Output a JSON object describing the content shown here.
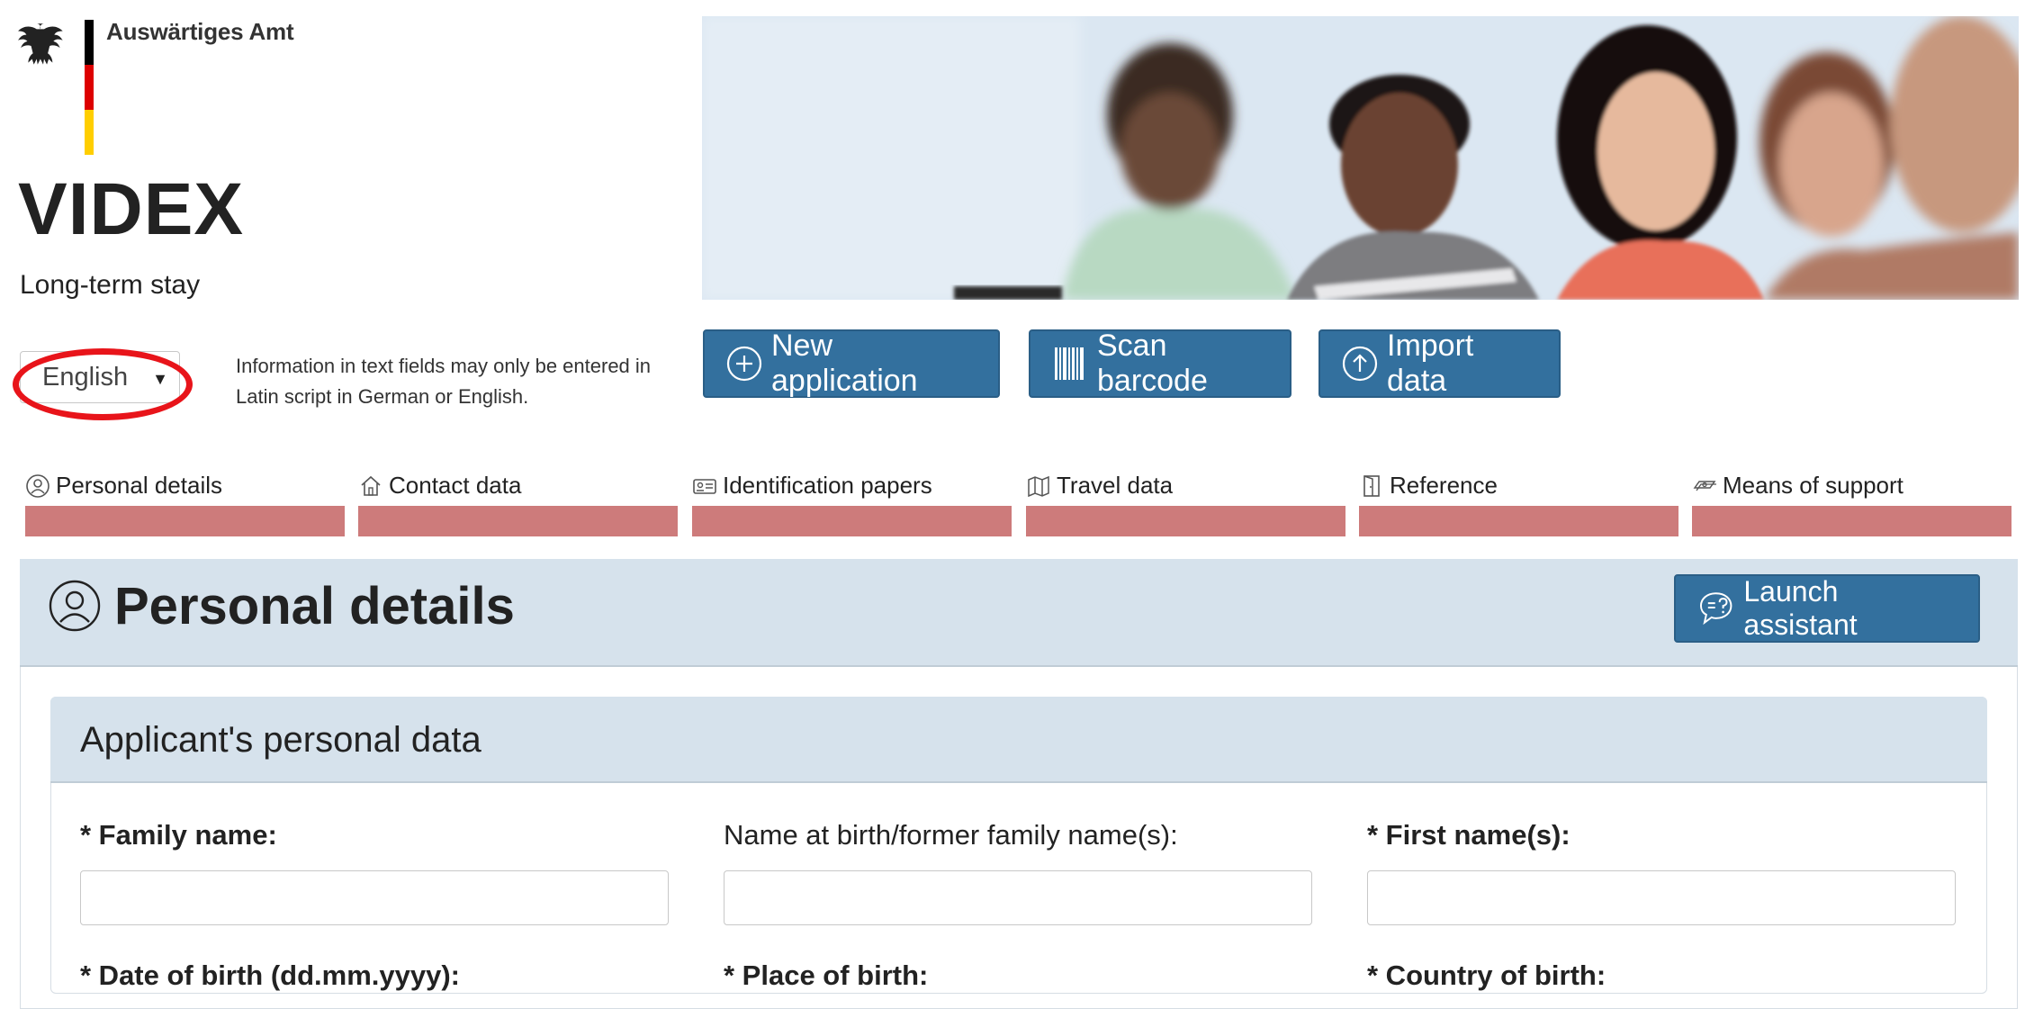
{
  "logo": {
    "ministry": "Auswärtiges Amt",
    "icon": "eagle-icon",
    "flag_colors": [
      "#000000",
      "#dd0000",
      "#ffce00"
    ]
  },
  "app": {
    "title": "VIDEX",
    "subtitle": "Long-term stay"
  },
  "language": {
    "selected": "English"
  },
  "info": {
    "text": "Information in text fields may only be entered in Latin script in German or English."
  },
  "actions": [
    {
      "label": "New application",
      "icon": "plus-circle-icon"
    },
    {
      "label": "Scan barcode",
      "icon": "barcode-icon"
    },
    {
      "label": "Import data",
      "icon": "upload-circle-icon"
    }
  ],
  "steps": [
    {
      "label": "Personal details",
      "icon": "person-icon"
    },
    {
      "label": "Contact data",
      "icon": "house-icon"
    },
    {
      "label": "Identification papers",
      "icon": "id-card-icon"
    },
    {
      "label": "Travel data",
      "icon": "map-icon"
    },
    {
      "label": "Reference",
      "icon": "door-icon"
    },
    {
      "label": "Means of support",
      "icon": "money-icon"
    }
  ],
  "step_bar_color": "#cd7b7b",
  "section": {
    "title": "Personal details",
    "assistant_label": "Launch assistant"
  },
  "card": {
    "title": "Applicant's personal data"
  },
  "fields": {
    "family_name": "* Family name:",
    "birth_name": "Name at birth/former family name(s):",
    "first_name": "* First name(s):",
    "date_of_birth": "* Date of birth (dd.mm.yyyy):",
    "place_of_birth": "* Place of birth:",
    "country_of_birth": "* Country of birth:"
  },
  "accent_color": "#33709e"
}
